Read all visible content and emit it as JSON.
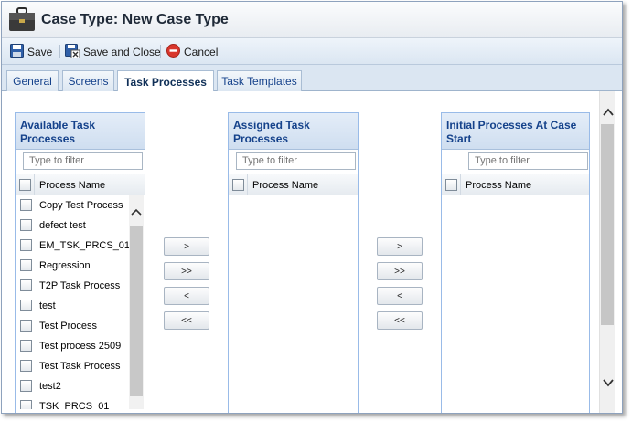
{
  "window": {
    "title": "Case Type: New Case Type"
  },
  "toolbar": {
    "save_label": "Save",
    "save_close_label": "Save and Close",
    "cancel_label": "Cancel"
  },
  "tabs": [
    {
      "label": "General"
    },
    {
      "label": "Screens"
    },
    {
      "label": "Task Processes",
      "active": true
    },
    {
      "label": "Task Templates"
    }
  ],
  "panels": {
    "available": {
      "title_line1": "Available Task",
      "title_line2": "Processes",
      "filter_placeholder": "Type to filter",
      "column_header": "Process Name",
      "items": [
        "Copy Test Process",
        "defect test",
        "EM_TSK_PRCS_01",
        "Regression",
        "T2P Task Process",
        "test",
        "Test Process",
        "Test process 2509",
        "Test Task Process",
        "test2",
        "TSK_PRCS_01"
      ]
    },
    "assigned": {
      "title_line1": "Assigned Task",
      "title_line2": "Processes",
      "filter_placeholder": "Type to filter",
      "column_header": "Process Name"
    },
    "initial": {
      "title_line1": "Initial Processes At Case",
      "title_line2": "Start",
      "filter_placeholder": "Type to filter",
      "column_header": "Process Name"
    }
  },
  "move_buttons": {
    "add": ">",
    "add_all": ">>",
    "remove": "<",
    "remove_all": "<<"
  },
  "colors": {
    "accent": "#15428b",
    "panel_border": "#99bbe8",
    "cancel_red": "#d9362c"
  },
  "icons": [
    "briefcase-icon",
    "save-icon",
    "save-close-icon",
    "cancel-icon",
    "scroll-up-icon",
    "scroll-down-icon"
  ]
}
